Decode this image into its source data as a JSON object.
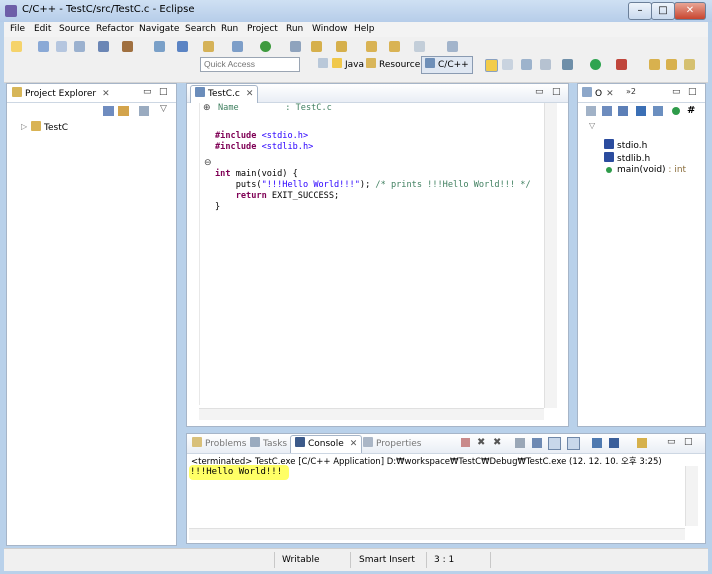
{
  "window": {
    "title": "C/C++ - TestC/src/TestC.c - Eclipse"
  },
  "menu": [
    "File",
    "Edit",
    "Source",
    "Refactor",
    "Navigate",
    "Search",
    "Run",
    "Project",
    "Run",
    "Window",
    "Help"
  ],
  "toolbar": {
    "quick_access_placeholder": "Quick Access"
  },
  "perspectives": [
    "Java",
    "Resource",
    "C/C++"
  ],
  "project_explorer": {
    "title": "Project Explorer",
    "tree": [
      "TestC"
    ]
  },
  "editor": {
    "tab": "TestC.c",
    "lines": [
      {
        "parts": [
          [
            "Name",
            "cm"
          ],
          [
            "         : TestC.c",
            "cm"
          ]
        ]
      },
      {
        "parts": []
      },
      {
        "parts": [
          [
            "#include ",
            "kw"
          ],
          [
            "<stdio.h>",
            "str"
          ]
        ]
      },
      {
        "parts": [
          [
            "#include ",
            "kw"
          ],
          [
            "<stdlib.h>",
            "str"
          ]
        ]
      },
      {
        "parts": []
      },
      {
        "parts": [
          [
            "int",
            "kw"
          ],
          [
            " main(void) {",
            ""
          ]
        ]
      },
      {
        "parts": [
          [
            "    puts(",
            ""
          ],
          [
            "\"!!!Hello World!!!\"",
            "str"
          ],
          [
            "); ",
            ""
          ],
          [
            "/* prints !!!Hello World!!! */",
            "cm"
          ]
        ]
      },
      {
        "parts": [
          [
            "    ",
            ""
          ],
          [
            "return",
            "kw"
          ],
          [
            " EXIT_SUCCESS;",
            ""
          ]
        ]
      },
      {
        "parts": [
          [
            "}",
            ""
          ]
        ]
      }
    ]
  },
  "outline": {
    "tab": "O",
    "overflow": "»2",
    "items": [
      {
        "label": "stdio.h",
        "kind": "include"
      },
      {
        "label": "stdlib.h",
        "kind": "include"
      },
      {
        "label": "main(void)",
        "type": " : int",
        "kind": "function"
      }
    ]
  },
  "console": {
    "tabs": [
      "Problems",
      "Tasks",
      "Console",
      "Properties"
    ],
    "status": "<terminated> TestC.exe [C/C++ Application] D:₩workspace₩TestC₩Debug₩TestC.exe (12. 12. 10. 오후 3:25)",
    "output": "!!!Hello World!!!"
  },
  "statusbar": {
    "mode": "Writable",
    "insert": "Smart Insert",
    "position": "3 : 1"
  },
  "colors": {
    "highlight": "#ffff66",
    "keyword": "#7f0055",
    "string": "#2a00ff",
    "comment": "#3f7f5f"
  }
}
